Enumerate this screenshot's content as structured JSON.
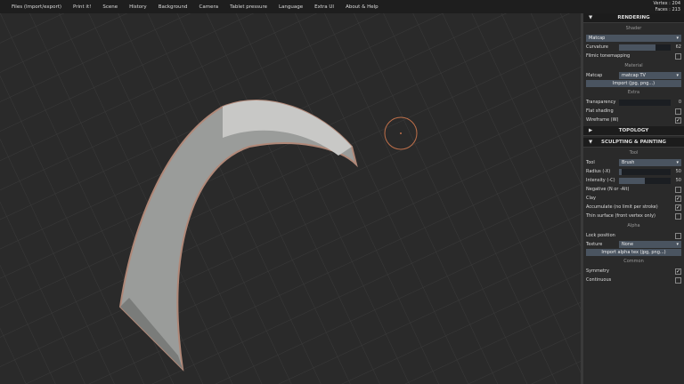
{
  "menu": [
    "Files (Import/export)",
    "Print it!",
    "Scene",
    "History",
    "Background",
    "Camera",
    "Tablet pressure",
    "Language",
    "Extra UI",
    "About & Help"
  ],
  "stats": {
    "vertices": "Vertex : 204",
    "faces": "Faces : 213"
  },
  "rendering": {
    "title": "RENDERING",
    "shader_section": "Shader",
    "shader": "Matcap",
    "curvature_label": "Curvature",
    "curvature_value": "62",
    "curvature_fraction": 0.7,
    "filmic_label": "Filmic tonemapping",
    "material_section": "Material",
    "matcap_label": "Matcap",
    "matcap_value": "matcap TV",
    "import_label": "Import (jpg, png...)",
    "extra_section": "Extra",
    "transparency_label": "Transparency",
    "transparency_value": "0",
    "flat_label": "Flat shading",
    "wireframe_label": "Wireframe (W)"
  },
  "topology": {
    "title": "TOPOLOGY"
  },
  "sculpting": {
    "title": "SCULPTING & PAINTING",
    "tool_section": "Tool",
    "tool_label": "Tool",
    "tool_value": "Brush",
    "radius_label": "Radius (-X)",
    "radius_value": "50",
    "radius_fraction": 0.05,
    "intensity_label": "Intensity (-C)",
    "intensity_value": "50",
    "intensity_fraction": 0.5,
    "negative_label": "Negative (N or -Alt)",
    "clay_label": "Clay",
    "accumulate_label": "Accumulate (no limit per stroke)",
    "thin_label": "Thin surface (front vertex only)",
    "alpha_section": "Alpha",
    "lock_label": "Lock position",
    "texture_label": "Texture",
    "texture_value": "None",
    "import_alpha_label": "Import alpha tex (jpg, png...)",
    "common_section": "Common",
    "symmetry_label": "Symmetry",
    "continuous_label": "Continuous"
  },
  "check": "✓"
}
